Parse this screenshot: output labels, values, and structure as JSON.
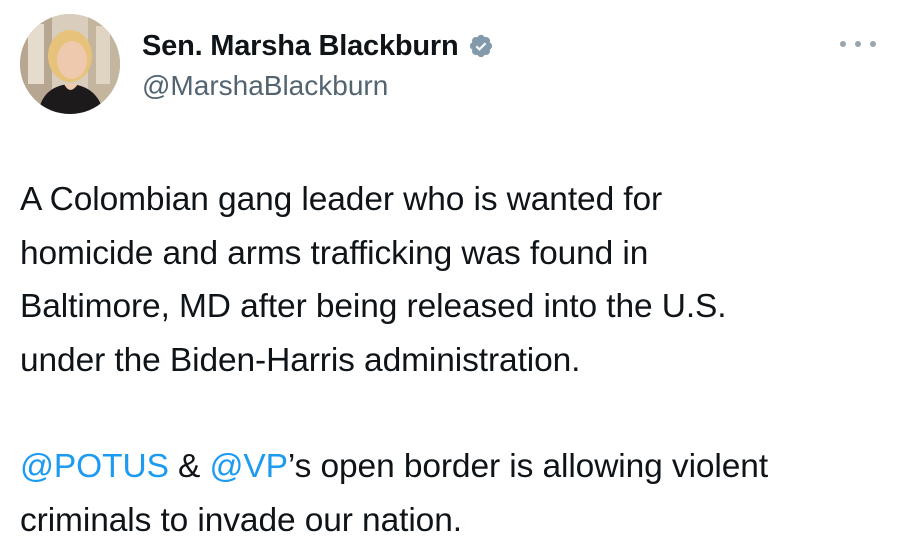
{
  "author": {
    "display_name": "Sen. Marsha Blackburn",
    "handle": "@MarshaBlackburn",
    "verified_icon": "verified-badge-icon",
    "verified_color": "#829aab"
  },
  "menu": {
    "icon": "more-options-icon"
  },
  "tweet": {
    "paragraph1_lines": [
      "A Colombian gang leader who is wanted for",
      "homicide and arms trafficking was found in",
      "Baltimore, MD after being released into the U.S.",
      "under the Biden-Harris administration."
    ],
    "mention_potus": "@POTUS",
    "ampersand": " & ",
    "mention_vp": "@VP",
    "line2_rest": "’s open border is allowing violent",
    "line3": "criminals to invade our nation."
  },
  "colors": {
    "text": "#0f1419",
    "secondary": "#536471",
    "link": "#1d9bf0"
  }
}
